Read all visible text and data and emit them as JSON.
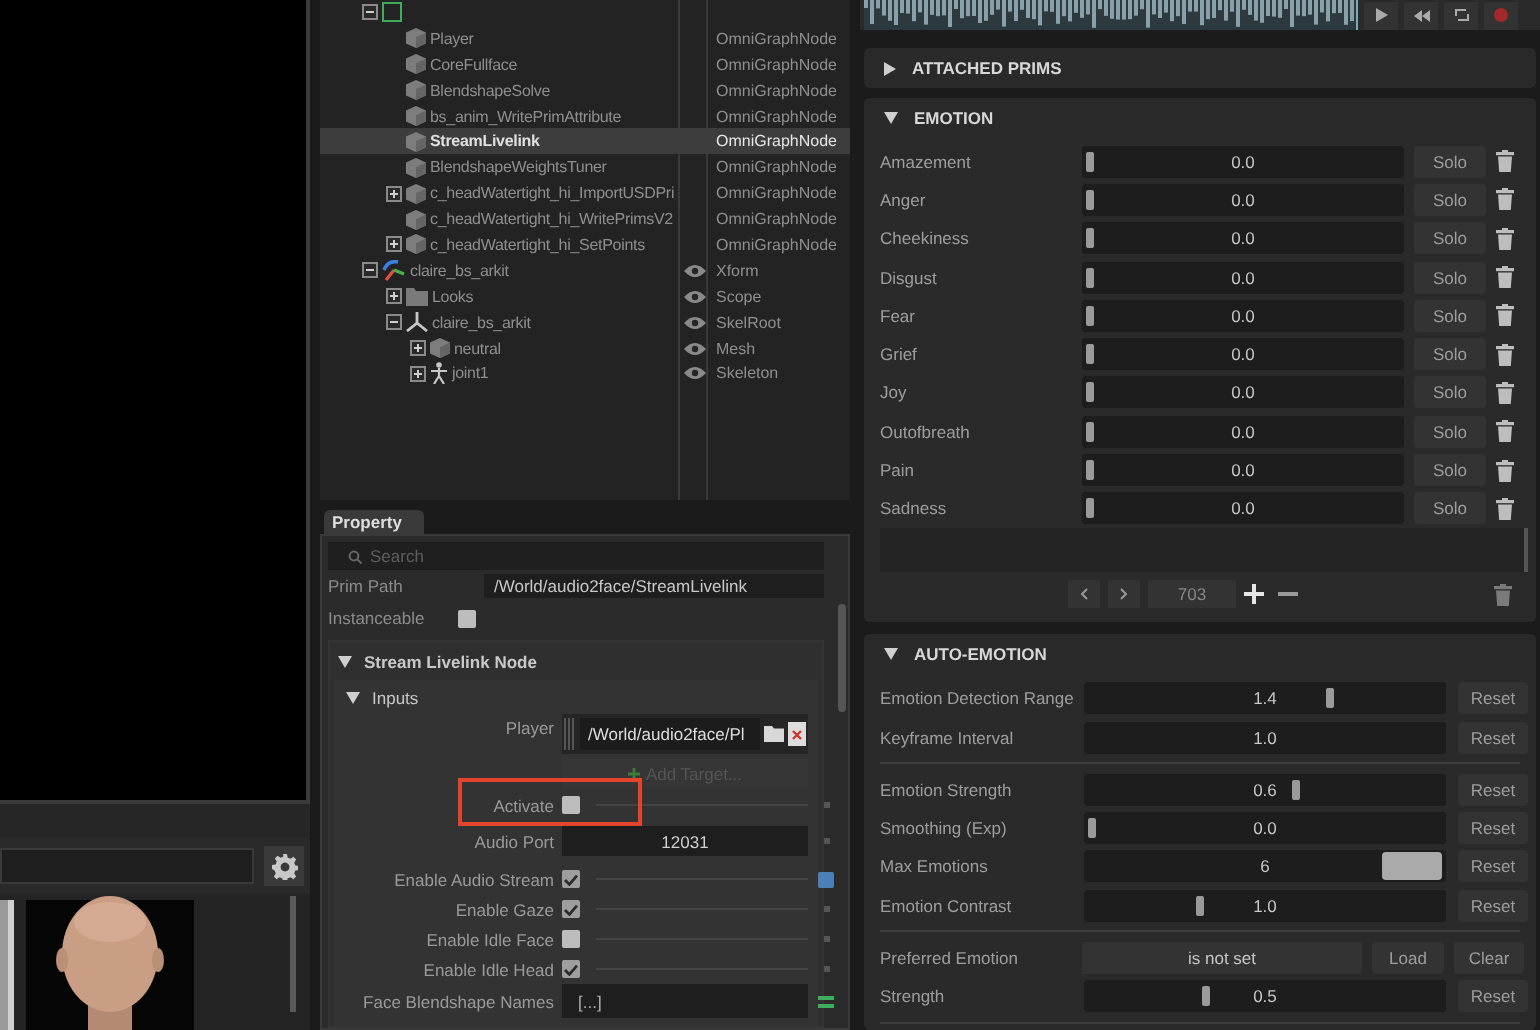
{
  "stage": {
    "tree": [
      {
        "kind": "graph",
        "expanded": true,
        "visible": false,
        "selected": false,
        "children": [
          {
            "label": "Player",
            "type": "OmniGraphNode",
            "kind": "node",
            "visible": false,
            "selected": false
          },
          {
            "label": "CoreFullface",
            "type": "OmniGraphNode",
            "kind": "node",
            "visible": false,
            "selected": false
          },
          {
            "label": "BlendshapeSolve",
            "type": "OmniGraphNode",
            "kind": "node",
            "visible": false,
            "selected": false
          },
          {
            "label": "bs_anim_WritePrimAttribute",
            "type": "OmniGraphNode",
            "kind": "node",
            "visible": false,
            "selected": false
          },
          {
            "label": "StreamLivelink",
            "type": "OmniGraphNode",
            "kind": "node",
            "visible": false,
            "selected": true
          },
          {
            "label": "BlendshapeWeightsTuner",
            "type": "OmniGraphNode",
            "kind": "node",
            "visible": false,
            "selected": false
          },
          {
            "label": "c_headWatertight_hi_ImportUSDPri",
            "type": "OmniGraphNode",
            "kind": "node",
            "expanded": false,
            "visible": false,
            "selected": false
          },
          {
            "label": "c_headWatertight_hi_WritePrimsV2",
            "type": "OmniGraphNode",
            "kind": "node",
            "visible": false,
            "selected": false
          },
          {
            "label": "c_headWatertight_hi_SetPoints",
            "type": "OmniGraphNode",
            "kind": "node",
            "expanded": false,
            "visible": false,
            "selected": false
          }
        ]
      },
      {
        "label": "claire_bs_arkit",
        "type": "Xform",
        "kind": "xform",
        "expanded": true,
        "visible": true,
        "selected": false,
        "children": [
          {
            "label": "Looks",
            "type": "Scope",
            "kind": "scope",
            "expanded": false,
            "visible": true,
            "selected": false
          },
          {
            "label": "claire_bs_arkit",
            "type": "SkelRoot",
            "kind": "skelroot",
            "expanded": true,
            "visible": true,
            "selected": false,
            "children": [
              {
                "label": "neutral",
                "type": "Mesh",
                "kind": "mesh",
                "expanded": false,
                "visible": true,
                "selected": false
              },
              {
                "label": "joint1",
                "type": "Skeleton",
                "kind": "skeleton",
                "expanded": false,
                "visible": true,
                "selected": false
              }
            ]
          }
        ]
      }
    ]
  },
  "property": {
    "tab": {
      "label": "Property",
      "selected": true
    },
    "search": {
      "placeholder": "Search"
    },
    "prim_path": {
      "label": "Prim Path",
      "value": "/World/audio2face/StreamLivelink"
    },
    "instanceable": {
      "label": "Instanceable",
      "checked": false
    },
    "section": {
      "title": "Stream Livelink Node",
      "expanded": true
    },
    "subsection": {
      "title": "Inputs",
      "expanded": true
    },
    "inputs": [
      {
        "kind": "target",
        "label": "Player",
        "value": "/World/audio2face/Pl",
        "add_label": "Add Target...",
        "highlighted": false
      },
      {
        "kind": "checkbox",
        "label": "Activate",
        "checked": false,
        "highlighted": true,
        "overridden": false
      },
      {
        "kind": "number",
        "label": "Audio Port",
        "value": "12031",
        "highlighted": false,
        "overridden": false
      },
      {
        "kind": "checkbox",
        "label": "Enable Audio Stream",
        "checked": true,
        "highlighted": false,
        "overridden": true
      },
      {
        "kind": "checkbox",
        "label": "Enable Gaze",
        "checked": true,
        "highlighted": false,
        "overridden": false
      },
      {
        "kind": "checkbox",
        "label": "Enable Idle Face",
        "checked": false,
        "highlighted": false,
        "overridden": false
      },
      {
        "kind": "checkbox",
        "label": "Enable Idle Head",
        "checked": true,
        "highlighted": false,
        "overridden": false
      },
      {
        "kind": "array",
        "label": "Face Blendshape Names",
        "value": "[...]",
        "highlighted": false
      }
    ]
  },
  "audio": {
    "attached_prims": {
      "title": "ATTACHED PRIMS",
      "expanded": false
    },
    "emotion": {
      "title": "EMOTION",
      "expanded": true,
      "rows": [
        {
          "name": "Amazement",
          "value": "0.0",
          "level": 0,
          "solo": "Solo"
        },
        {
          "name": "Anger",
          "value": "0.0",
          "level": 0,
          "solo": "Solo"
        },
        {
          "name": "Cheekiness",
          "value": "0.0",
          "level": 0,
          "solo": "Solo"
        },
        {
          "name": "Disgust",
          "value": "0.0",
          "level": 0,
          "solo": "Solo"
        },
        {
          "name": "Fear",
          "value": "0.0",
          "level": 0,
          "solo": "Solo"
        },
        {
          "name": "Grief",
          "value": "0.0",
          "level": 0,
          "solo": "Solo"
        },
        {
          "name": "Joy",
          "value": "0.0",
          "level": 0,
          "solo": "Solo"
        },
        {
          "name": "Outofbreath",
          "value": "0.0",
          "level": 0,
          "solo": "Solo"
        },
        {
          "name": "Pain",
          "value": "0.0",
          "level": 0,
          "solo": "Solo"
        },
        {
          "name": "Sadness",
          "value": "0.0",
          "level": 0,
          "solo": "Solo"
        }
      ],
      "frame": "703"
    },
    "auto_emotion": {
      "title": "AUTO-EMOTION",
      "expanded": true,
      "groups": [
        [
          {
            "kind": "slider",
            "label": "Emotion Detection Range",
            "value": "1.4",
            "level": 0.69,
            "reset": "Reset"
          },
          {
            "kind": "slider",
            "label": "Keyframe Interval",
            "value": "1.0",
            "level": 0.48,
            "reset": "Reset"
          }
        ],
        [
          {
            "kind": "slider",
            "label": "Emotion Strength",
            "value": "0.6",
            "level": 0.59,
            "reset": "Reset"
          },
          {
            "kind": "slider",
            "label": "Smoothing (Exp)",
            "value": "0.0",
            "level": 0,
            "reset": "Reset"
          },
          {
            "kind": "int_slider",
            "label": "Max Emotions",
            "value": "6",
            "level": 1,
            "reset": "Reset"
          },
          {
            "kind": "slider",
            "label": "Emotion Contrast",
            "value": "1.0",
            "level": 0.31,
            "reset": "Reset"
          }
        ],
        [
          {
            "kind": "choice",
            "label": "Preferred Emotion",
            "value": "is not set",
            "load": "Load",
            "clear": "Clear"
          },
          {
            "kind": "slider",
            "label": "Strength",
            "value": "0.5",
            "level": 0.33,
            "reset": "Reset"
          }
        ]
      ]
    }
  }
}
